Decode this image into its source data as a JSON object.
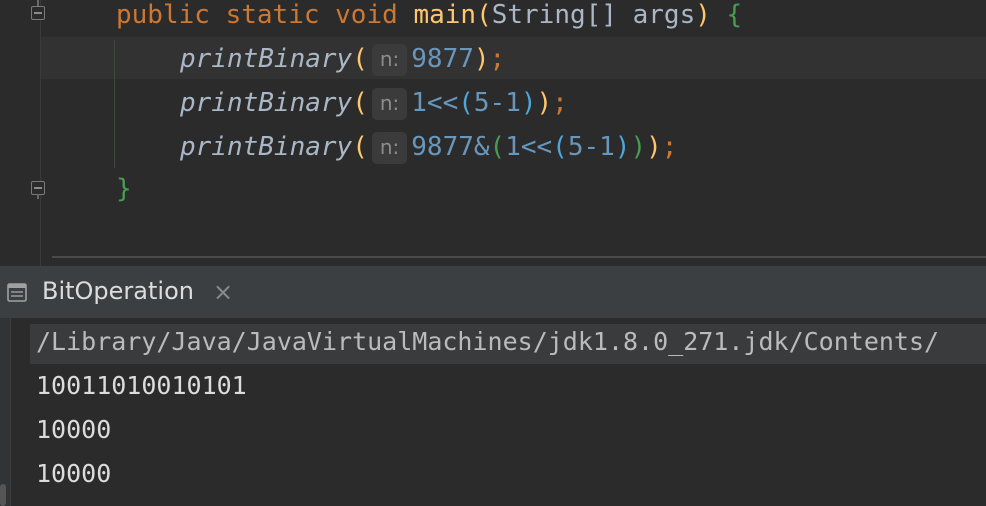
{
  "editor": {
    "line1": {
      "keyword_public": "public",
      "keyword_static": "static",
      "keyword_void": "void",
      "method_name": "main",
      "open_paren": "(",
      "param_type": "String[]",
      "param_name": "args",
      "close_paren": ")",
      "open_brace": "{"
    },
    "calls": [
      {
        "name": "printBinary",
        "hint": "n:",
        "arg_parts": [
          "9877"
        ],
        "tail": ";"
      },
      {
        "name": "printBinary",
        "hint": "n:",
        "arg_parts": [
          "1<<",
          "(",
          "5-1",
          ")"
        ],
        "tail": ";"
      },
      {
        "name": "printBinary",
        "hint": "n:",
        "arg_parts": [
          "9877&",
          "(",
          "1<<",
          "(",
          "5-1",
          ")",
          ")"
        ],
        "tail": ";"
      }
    ],
    "close_brace": "}"
  },
  "run_panel": {
    "tab_label": "BitOperation",
    "close_glyph": "×",
    "icon": "tool-window-icon"
  },
  "console": {
    "command": "/Library/Java/JavaVirtualMachines/jdk1.8.0_271.jdk/Contents/",
    "output": [
      "10011010010101",
      "10000",
      "10000"
    ]
  },
  "colors": {
    "background": "#2b2b2b",
    "keyword": "#cc7832",
    "method": "#ffc66d",
    "number": "#6897bb",
    "brace": "#499c54"
  }
}
